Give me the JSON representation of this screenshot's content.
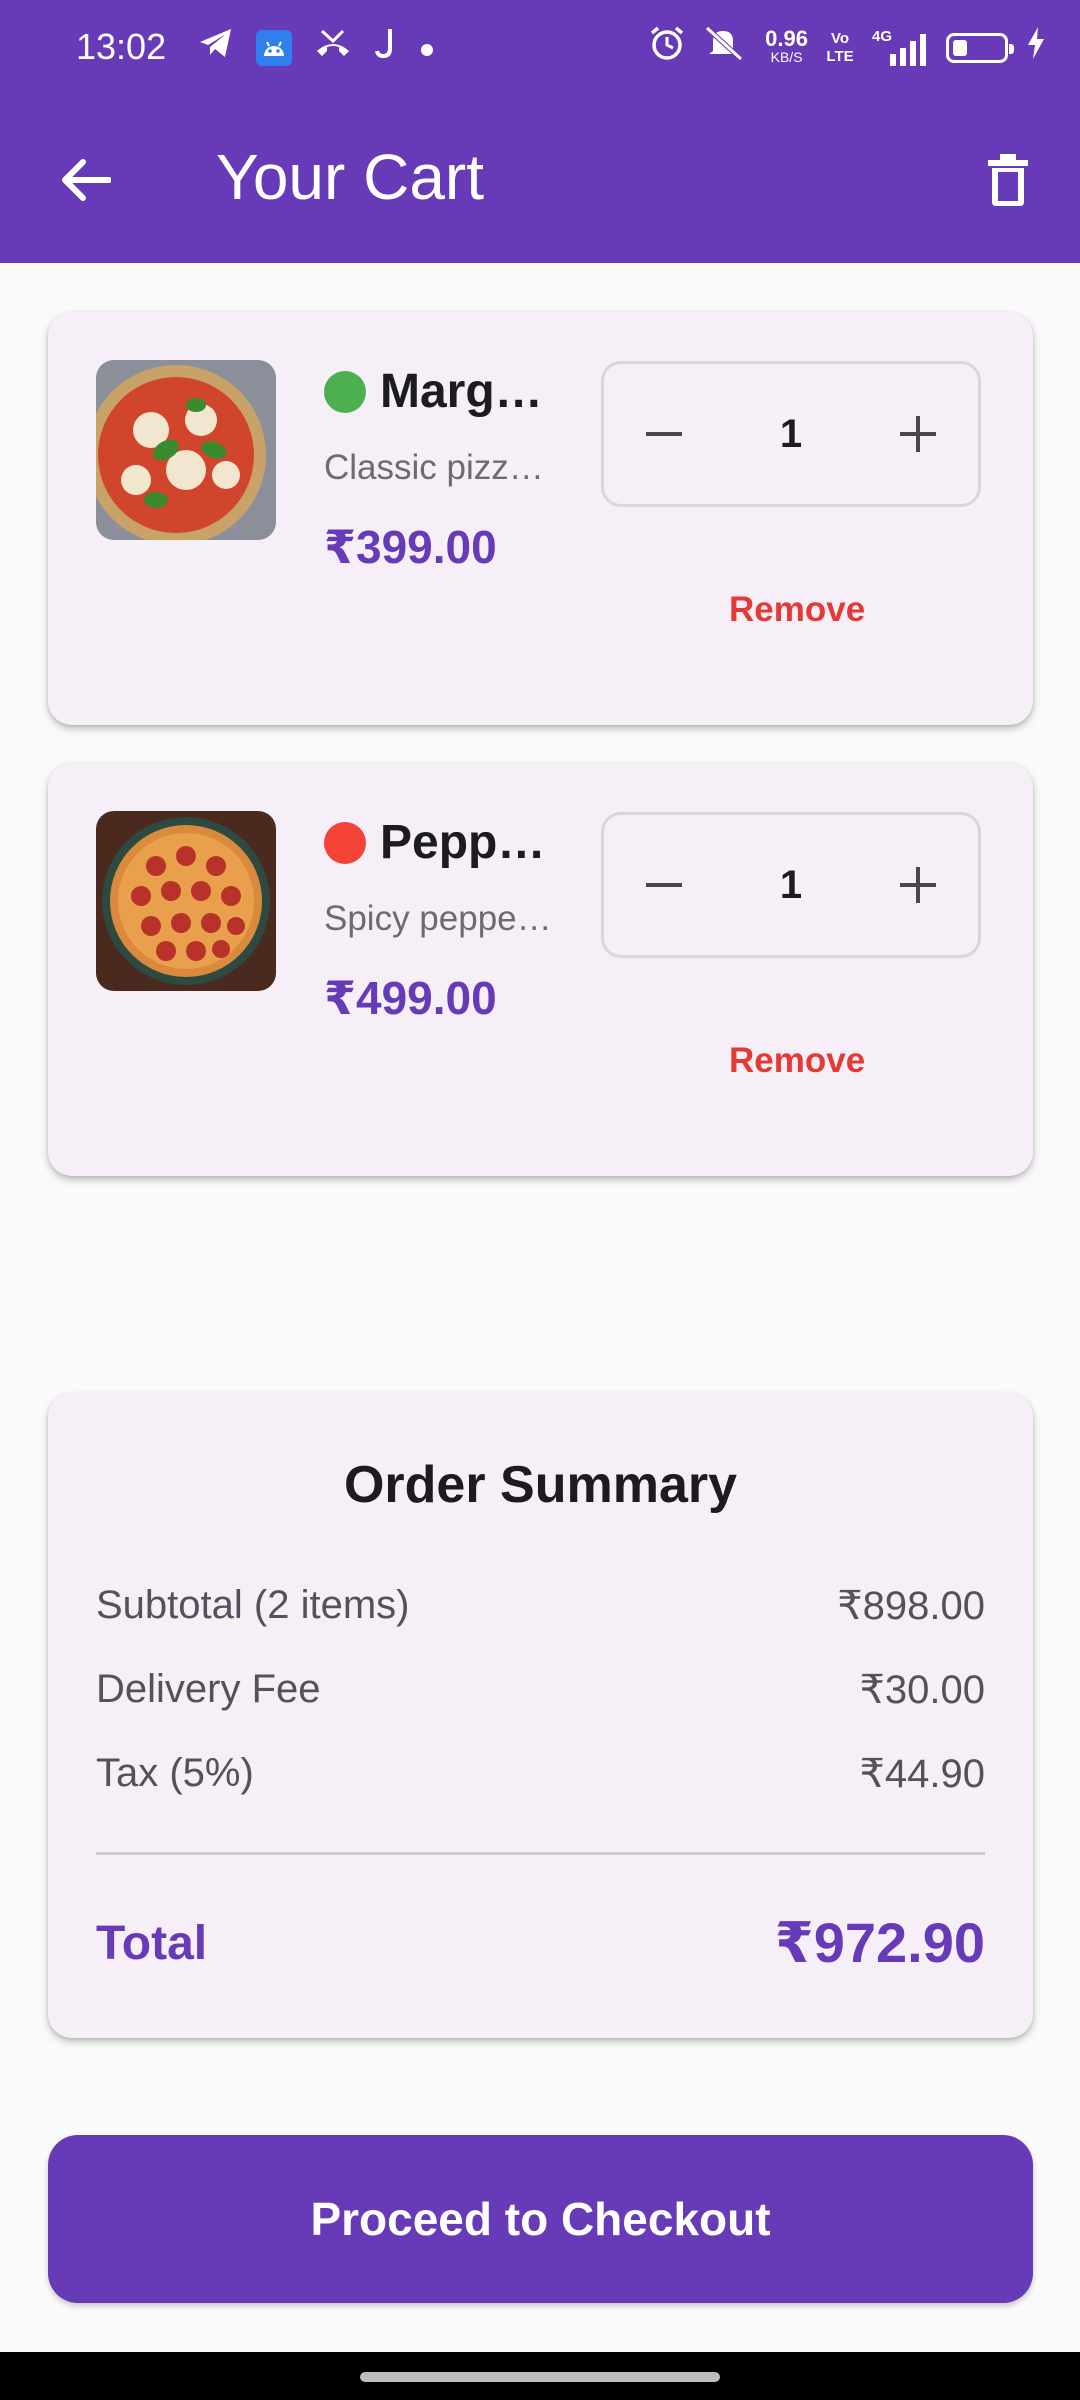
{
  "status_bar": {
    "time": "13:02",
    "net_speed_value": "0.96",
    "net_speed_unit": "KB/S",
    "volte": "Vo LTE",
    "network": "4G",
    "left_icons": [
      "telegram-icon",
      "android-icon",
      "missed-call-icon",
      "j-app-icon",
      "dot-icon"
    ],
    "right_icons": [
      "alarm-icon",
      "silent-icon",
      "signal-icon",
      "battery-icon",
      "charging-icon"
    ],
    "battery_level": 0.3
  },
  "header": {
    "title": "Your Cart",
    "back_icon": "arrow-left-icon",
    "trash_icon": "trash-icon"
  },
  "cart": {
    "items": [
      {
        "name": "Marg…",
        "description": "Classic pizz…",
        "price": "₹399.00",
        "quantity": "1",
        "remove_label": "Remove",
        "type_icon": "green-dot-icon",
        "type_color": "#4CAF50"
      },
      {
        "name": "Pepp…",
        "description": "Spicy peppe…",
        "price": "₹499.00",
        "quantity": "1",
        "remove_label": "Remove",
        "type_icon": "red-dot-icon",
        "type_color": "#F44336"
      }
    ]
  },
  "summary": {
    "title": "Order Summary",
    "rows": [
      {
        "label": "Subtotal (2 items)",
        "value": "₹898.00"
      },
      {
        "label": "Delivery Fee",
        "value": "₹30.00"
      },
      {
        "label": "Tax (5%)",
        "value": "₹44.90"
      }
    ],
    "total_label": "Total",
    "total_value": "₹972.90"
  },
  "checkout": {
    "label": "Proceed to Checkout"
  },
  "colors": {
    "primary": "#673AB7",
    "danger": "#E53935",
    "card_bg": "#F6EFF8",
    "page_bg": "#FAFAFA"
  }
}
